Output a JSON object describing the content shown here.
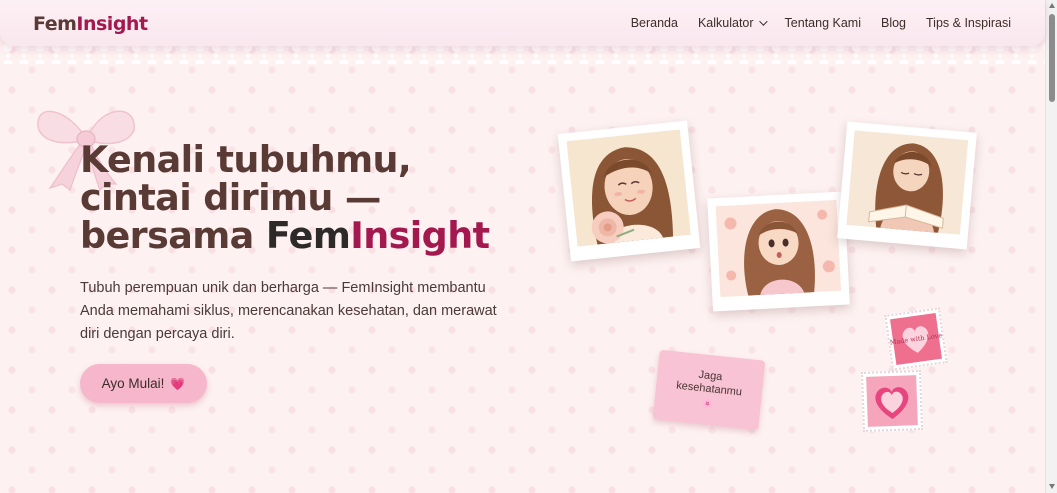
{
  "brand": {
    "part1": "Fem",
    "part2": "Insight"
  },
  "nav": {
    "items": [
      {
        "label": "Beranda"
      },
      {
        "label": "Kalkulator"
      },
      {
        "label": "Tentang Kami"
      },
      {
        "label": "Blog"
      },
      {
        "label": "Tips & Inspirasi"
      }
    ]
  },
  "hero": {
    "title_line1": "Kenali tubuhmu,",
    "title_line2": "cintai dirimu —",
    "title_line3_prefix": "bersama ",
    "title_brand_part1": "Fem",
    "title_brand_part2": "Insight",
    "description": "Tubuh perempuan unik dan berharga — FemInsight membantu Anda memahami siklus, merencanakan kesehatan, dan merawat diri dengan percaya diri.",
    "cta_label": "Ayo Mulai!",
    "cta_icon": "💗"
  },
  "note": {
    "line1": "Jaga",
    "line2": "kesehatanmu",
    "icon": "🌸"
  },
  "stamp1": {
    "text": "Made with Love"
  },
  "colors": {
    "accent": "#a3184f",
    "brown": "#5a3a35",
    "cta": "#f6b7cc",
    "background": "#fdf1f1"
  }
}
